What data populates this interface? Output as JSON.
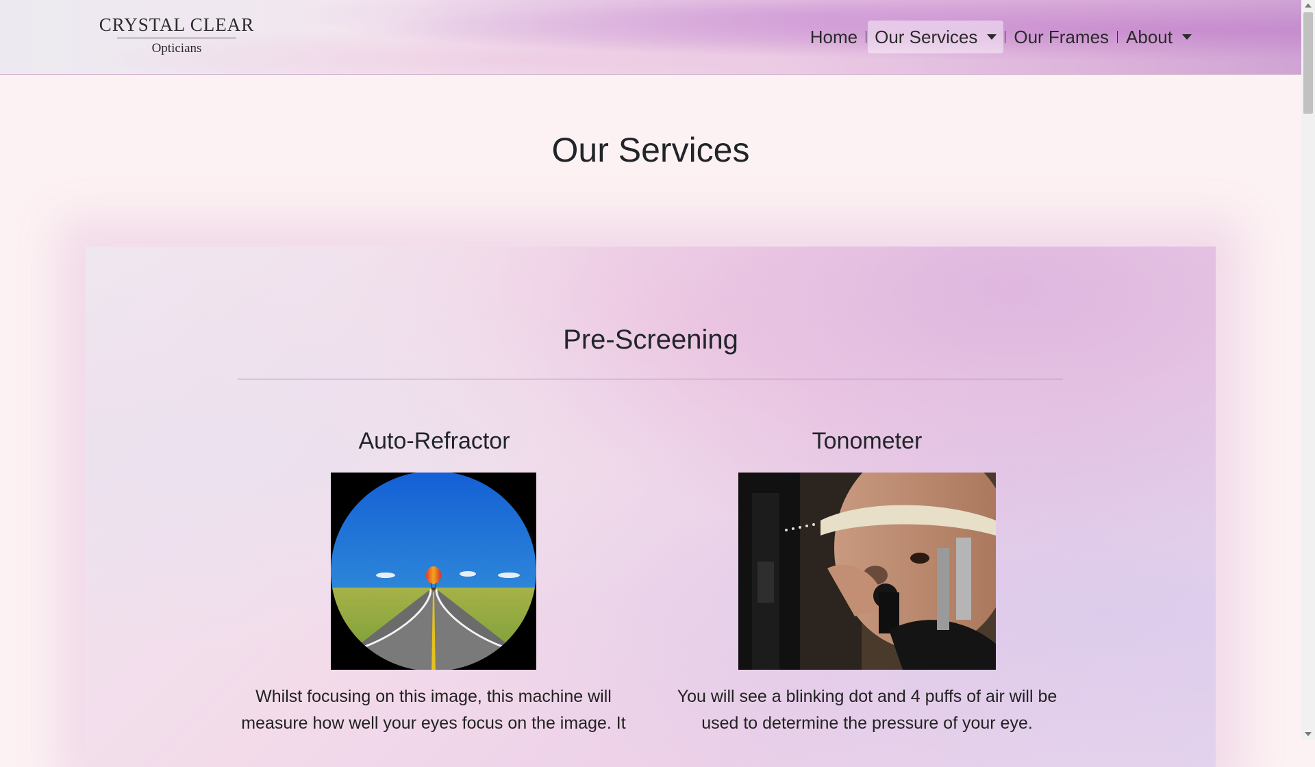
{
  "brand": {
    "name": "CRYSTAL CLEAR",
    "subtitle": "Opticians"
  },
  "nav": {
    "items": [
      {
        "label": "Home",
        "active": false,
        "dropdown": false
      },
      {
        "label": "Our Services",
        "active": true,
        "dropdown": true
      },
      {
        "label": "Our Frames",
        "active": false,
        "dropdown": false
      },
      {
        "label": "About",
        "active": false,
        "dropdown": true
      }
    ]
  },
  "page": {
    "title": "Our Services"
  },
  "section": {
    "title": "Pre-Screening",
    "services": [
      {
        "title": "Auto-Refractor",
        "image": "hot-air-balloon-over-road",
        "text_lines": [
          "Whilst focusing on this image, this machine will",
          "measure how well your eyes focus on the image. It"
        ]
      },
      {
        "title": "Tonometer",
        "image": "patient-at-tonometer",
        "text_lines": [
          "You will see a blinking dot and 4 puffs of air will be",
          "used to determine the pressure of your eye."
        ]
      }
    ]
  },
  "colors": {
    "accent_rule": "#b98bb4",
    "text": "#212529",
    "background": "#fdf2f3"
  }
}
